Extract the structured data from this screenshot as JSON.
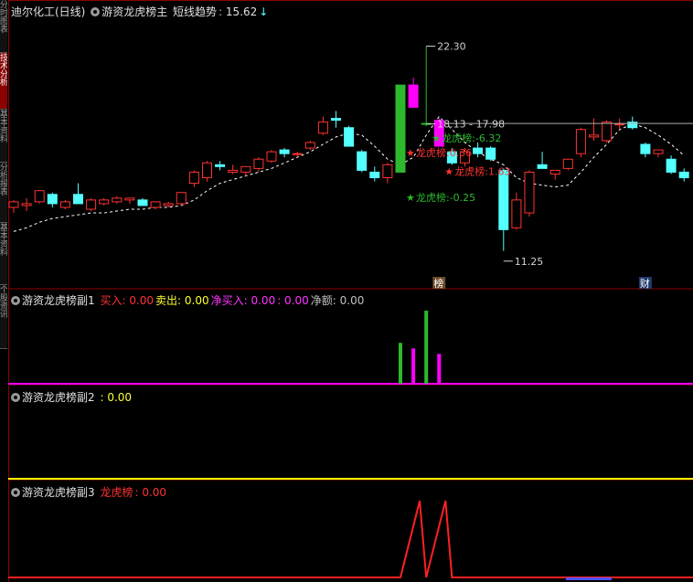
{
  "sidebar": {
    "tabs": [
      {
        "label": "分时图表"
      },
      {
        "label": "技术分析",
        "active": true
      },
      {
        "label": "基本资料"
      },
      {
        "label": "分析报表"
      },
      {
        "label": "基本资料"
      },
      {
        "label": "个股资讯"
      }
    ]
  },
  "panel_main": {
    "stock_name": "迪尔化工(日线)",
    "indicator": "游资龙虎榜主",
    "trend_label": "短线趋势",
    "trend_value": "15.62",
    "trend_arrow": "↓"
  },
  "panel_sub1": {
    "name": "游资龙虎榜副1",
    "items": [
      {
        "label": "买入",
        "value": "0.00",
        "color": "#ff3333"
      },
      {
        "label": "卖出",
        "value": "0.00",
        "color": "#ffff33"
      },
      {
        "label": "净买入",
        "value": "0.00",
        "color": "#ff33ff"
      },
      {
        "label": "",
        "value": "0.00",
        "color": "#ff33ff"
      },
      {
        "label": "净额",
        "value": "0.00",
        "color": "#c0c0c0"
      }
    ]
  },
  "panel_sub2": {
    "name": "游资龙虎榜副2",
    "value": "0.00"
  },
  "panel_sub3": {
    "name": "游资龙虎榜副3",
    "label": "龙虎榜",
    "value": "0.00"
  },
  "colors": {
    "up": "#ff3232",
    "down": "#54ffff",
    "trend": "#ffffff",
    "green": "#2eb82e",
    "magenta": "#ff00ff",
    "yellow": "#ffff00"
  },
  "chart_data": [
    {
      "type": "candlestick",
      "title": "迪尔化工(日线)",
      "ylim": [
        10,
        24
      ],
      "candles": [
        {
          "o": 13.6,
          "h": 14.0,
          "l": 13.3,
          "c": 13.9
        },
        {
          "o": 13.7,
          "h": 14.1,
          "l": 13.4,
          "c": 13.8
        },
        {
          "o": 13.9,
          "h": 14.5,
          "l": 13.8,
          "c": 14.5
        },
        {
          "o": 14.3,
          "h": 14.4,
          "l": 13.6,
          "c": 13.8
        },
        {
          "o": 13.6,
          "h": 14.0,
          "l": 13.5,
          "c": 13.9
        },
        {
          "o": 14.3,
          "h": 14.9,
          "l": 13.8,
          "c": 13.8
        },
        {
          "o": 13.5,
          "h": 14.1,
          "l": 13.4,
          "c": 14.0
        },
        {
          "o": 13.8,
          "h": 14.1,
          "l": 13.7,
          "c": 14.0
        },
        {
          "o": 13.9,
          "h": 14.2,
          "l": 13.8,
          "c": 14.1
        },
        {
          "o": 14.0,
          "h": 14.1,
          "l": 13.8,
          "c": 14.1
        },
        {
          "o": 14.0,
          "h": 14.1,
          "l": 13.8,
          "c": 13.7
        },
        {
          "o": 13.6,
          "h": 13.9,
          "l": 13.5,
          "c": 13.9
        },
        {
          "o": 13.7,
          "h": 13.9,
          "l": 13.6,
          "c": 13.8
        },
        {
          "o": 13.8,
          "h": 14.4,
          "l": 13.7,
          "c": 14.4
        },
        {
          "o": 14.9,
          "h": 15.6,
          "l": 14.7,
          "c": 15.5
        },
        {
          "o": 15.2,
          "h": 16.1,
          "l": 15.0,
          "c": 16.0
        },
        {
          "o": 15.9,
          "h": 16.1,
          "l": 15.6,
          "c": 15.8
        },
        {
          "o": 15.5,
          "h": 15.9,
          "l": 15.4,
          "c": 15.6
        },
        {
          "o": 15.5,
          "h": 15.8,
          "l": 15.3,
          "c": 15.8
        },
        {
          "o": 15.7,
          "h": 16.3,
          "l": 15.5,
          "c": 16.2
        },
        {
          "o": 16.1,
          "h": 16.7,
          "l": 16.0,
          "c": 16.6
        },
        {
          "o": 16.7,
          "h": 16.8,
          "l": 16.3,
          "c": 16.5
        },
        {
          "o": 16.5,
          "h": 16.6,
          "l": 16.3,
          "c": 16.5
        },
        {
          "o": 16.8,
          "h": 17.2,
          "l": 16.7,
          "c": 17.1
        },
        {
          "o": 17.6,
          "h": 18.5,
          "l": 17.5,
          "c": 18.2
        },
        {
          "o": 18.4,
          "h": 18.8,
          "l": 17.9,
          "c": 18.3
        },
        {
          "o": 17.9,
          "h": 18.0,
          "l": 16.9,
          "c": 16.9
        },
        {
          "o": 16.6,
          "h": 16.7,
          "l": 15.5,
          "c": 15.6
        },
        {
          "o": 15.5,
          "h": 15.8,
          "l": 15.0,
          "c": 15.2
        },
        {
          "o": 15.2,
          "h": 16.0,
          "l": 14.9,
          "c": 15.9
        },
        {
          "o": 15.5,
          "h": 20.2,
          "l": 15.5,
          "c": 20.2,
          "color": "#2eb82e"
        },
        {
          "o": 20.2,
          "h": 20.6,
          "l": 19.0,
          "c": 19.0,
          "color": "#ff00ff"
        },
        {
          "o": 18.1,
          "h": 22.3,
          "l": 17.98,
          "c": 18.13,
          "color": "#2eb82e"
        },
        {
          "o": 18.3,
          "h": 18.4,
          "l": 16.9,
          "c": 16.9,
          "color": "#ff00ff"
        },
        {
          "o": 16.6,
          "h": 16.8,
          "l": 15.9,
          "c": 16.0
        },
        {
          "o": 16.0,
          "h": 16.8,
          "l": 15.8,
          "c": 16.6
        },
        {
          "o": 16.8,
          "h": 17.1,
          "l": 16.3,
          "c": 16.5
        },
        {
          "o": 16.8,
          "h": 16.9,
          "l": 16.1,
          "c": 16.2
        },
        {
          "o": 15.6,
          "h": 15.7,
          "l": 11.25,
          "c": 12.4
        },
        {
          "o": 12.5,
          "h": 14.4,
          "l": 12.4,
          "c": 14.0
        },
        {
          "o": 13.3,
          "h": 15.6,
          "l": 13.1,
          "c": 15.5
        },
        {
          "o": 15.9,
          "h": 16.6,
          "l": 15.7,
          "c": 15.7
        },
        {
          "o": 15.4,
          "h": 15.6,
          "l": 15.1,
          "c": 15.6
        },
        {
          "o": 15.7,
          "h": 16.2,
          "l": 15.6,
          "c": 16.2
        },
        {
          "o": 16.5,
          "h": 17.9,
          "l": 16.3,
          "c": 17.8
        },
        {
          "o": 17.4,
          "h": 18.4,
          "l": 17.2,
          "c": 17.5
        },
        {
          "o": 17.2,
          "h": 18.3,
          "l": 17.1,
          "c": 18.2
        },
        {
          "o": 18.1,
          "h": 18.4,
          "l": 17.8,
          "c": 18.1
        },
        {
          "o": 18.2,
          "h": 18.5,
          "l": 17.8,
          "c": 17.9
        },
        {
          "o": 17.0,
          "h": 17.1,
          "l": 16.3,
          "c": 16.5
        },
        {
          "o": 16.5,
          "h": 16.7,
          "l": 16.3,
          "c": 16.7
        },
        {
          "o": 16.2,
          "h": 16.4,
          "l": 15.4,
          "c": 15.5
        },
        {
          "o": 15.5,
          "h": 15.7,
          "l": 15.0,
          "c": 15.2
        }
      ],
      "trend_line": [
        12.3,
        12.5,
        12.8,
        13.0,
        13.1,
        13.2,
        13.3,
        13.3,
        13.4,
        13.5,
        13.5,
        13.6,
        13.6,
        13.7,
        14.0,
        14.5,
        14.9,
        15.1,
        15.3,
        15.5,
        15.7,
        16.0,
        16.3,
        16.6,
        17.0,
        17.4,
        17.6,
        17.5,
        16.9,
        16.2,
        15.9,
        16.3,
        17.5,
        18.5,
        17.8,
        17.1,
        16.6,
        16.2,
        15.9,
        15.2,
        14.9,
        14.8,
        14.7,
        14.8,
        15.5,
        16.3,
        17.0,
        17.8,
        18.1,
        17.9,
        17.5,
        17.0,
        16.4
      ],
      "annotations": [
        {
          "text": "22.30",
          "idx": 32,
          "value": 22.3
        },
        {
          "text": "18.13 - 17.98",
          "idx": 32,
          "value": 18.1
        },
        {
          "text": "龙虎榜:-6.32",
          "idx": 32,
          "value": 17.35,
          "color": "#2eb82e"
        },
        {
          "text": "龙虎榜:0.36",
          "idx": 30,
          "value": 16.55,
          "color": "#ff3232"
        },
        {
          "text": "龙虎榜:1.63",
          "idx": 33,
          "value": 15.55,
          "color": "#ff3232"
        },
        {
          "text": "龙虎榜:-0.25",
          "idx": 30,
          "value": 14.15,
          "color": "#2eb82e"
        },
        {
          "text": "11.25",
          "idx": 38,
          "value": 10.7
        }
      ],
      "reference_price": 18.13,
      "markers": [
        {
          "text": "榜",
          "idx": 33
        },
        {
          "text": "财",
          "idx": 49
        }
      ]
    },
    {
      "type": "bar",
      "title": "游资龙虎榜副1",
      "ylim": [
        0,
        10
      ],
      "bars": [
        {
          "idx": 30,
          "value": 5.2,
          "color": "#2eb82e"
        },
        {
          "idx": 31,
          "value": 4.5,
          "color": "#ff00ff"
        },
        {
          "idx": 32,
          "value": 9.3,
          "color": "#2eb82e"
        },
        {
          "idx": 33,
          "value": 3.8,
          "color": "#ff00ff"
        }
      ]
    },
    {
      "type": "line",
      "title": "游资龙虎榜副2",
      "values": [
        0.0
      ]
    },
    {
      "type": "line",
      "title": "游资龙虎榜副3",
      "ylim": [
        0,
        1
      ],
      "values": [
        0,
        0,
        0,
        0,
        0,
        0,
        0,
        0,
        0,
        0,
        0,
        0,
        0,
        0,
        0,
        0,
        0,
        0,
        0,
        0,
        0,
        0,
        0,
        0,
        0,
        0,
        0,
        0,
        0,
        0,
        0,
        1,
        0,
        1,
        0,
        0,
        0,
        0,
        0,
        0,
        0,
        0,
        0,
        0,
        0,
        0,
        0,
        0,
        0,
        0,
        0,
        0,
        0
      ]
    }
  ]
}
